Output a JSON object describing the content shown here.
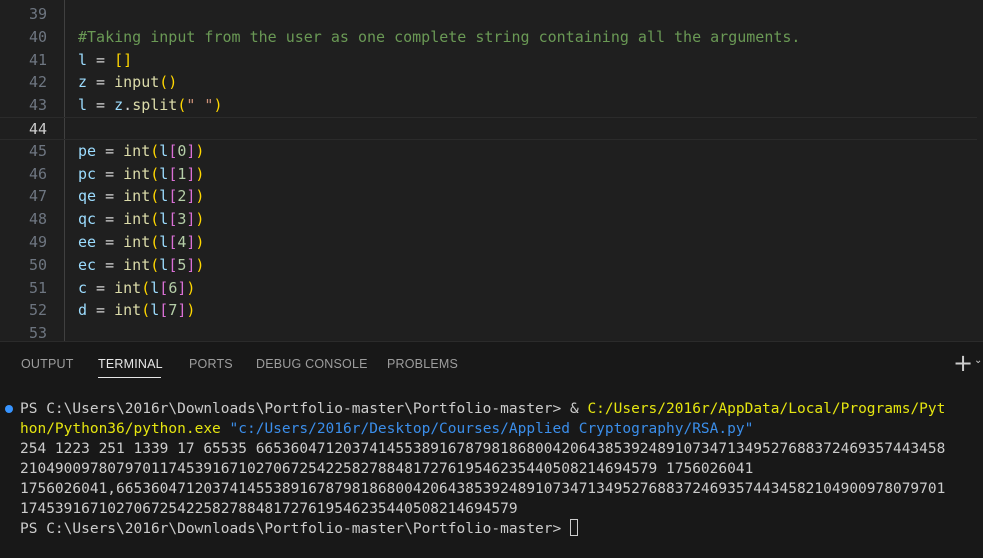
{
  "editor": {
    "lines": [
      {
        "n": "39"
      },
      {
        "n": "40",
        "comment": "#Taking input from the user as one complete string containing all the arguments."
      },
      {
        "n": "41",
        "var": "l",
        "op": " = ",
        "b": "[]"
      },
      {
        "n": "42",
        "var": "z",
        "op": " = ",
        "func": "input",
        "b": "()"
      },
      {
        "n": "43",
        "var": "l",
        "op": " = ",
        "obj": "z",
        "dot": ".",
        "func": "split",
        "bo": "(",
        "str": "\" \"",
        "bc": ")"
      },
      {
        "n": "44"
      },
      {
        "n": "45",
        "var": "pe",
        "func": "int",
        "arg": "l",
        "idx": "0"
      },
      {
        "n": "46",
        "var": "pc",
        "func": "int",
        "arg": "l",
        "idx": "1"
      },
      {
        "n": "47",
        "var": "qe",
        "func": "int",
        "arg": "l",
        "idx": "2"
      },
      {
        "n": "48",
        "var": "qc",
        "func": "int",
        "arg": "l",
        "idx": "3"
      },
      {
        "n": "49",
        "var": "ee",
        "func": "int",
        "arg": "l",
        "idx": "4"
      },
      {
        "n": "50",
        "var": "ec",
        "func": "int",
        "arg": "l",
        "idx": "5"
      },
      {
        "n": "51",
        "var": "c",
        "func": "int",
        "arg": "l",
        "idx": "6"
      },
      {
        "n": "52",
        "var": "d",
        "func": "int",
        "arg": "l",
        "idx": "7"
      },
      {
        "n": "53"
      }
    ],
    "eq": " = ",
    "paren_open": "(",
    "paren_close": ")",
    "bracket_open": "[",
    "bracket_close": "]"
  },
  "panel": {
    "tabs": [
      "OUTPUT",
      "TERMINAL",
      "PORTS",
      "DEBUG CONSOLE",
      "PROBLEMS"
    ],
    "active_tab": "TERMINAL",
    "new_terminal_icon": "plus-icon",
    "dropdown_icon": "chevron-down-icon"
  },
  "terminal": {
    "prompt1": "PS C:\\Users\\2016r\\Downloads\\Portfolio-master\\Portfolio-master> ",
    "amp": "& ",
    "exe_part1": "C:/Users/2016r/AppData/Local/Programs/Pyt",
    "exe_part2": "hon/Python36/python.exe",
    "script": "\"c:/Users/2016r/Desktop/Courses/Applied Cryptography/RSA.py\"",
    "out1": "254 1223 251 1339 17 65535 665360471203741455389167879818680042064385392489107347134952768837246935744345​8",
    "out2": "2104900978079701174539167102706725422582788481727619546235440508214694579 1756026041",
    "out3": "1756026041,6653604712037414553891678798186800420643853924891073471349527688372469357443458210490097807970​1",
    "out4": "1745391671027067254225827884817276195462354405082146945​79",
    "prompt2": "PS C:\\Users\\2016r\\Downloads\\Portfolio-master\\Portfolio-master> "
  }
}
